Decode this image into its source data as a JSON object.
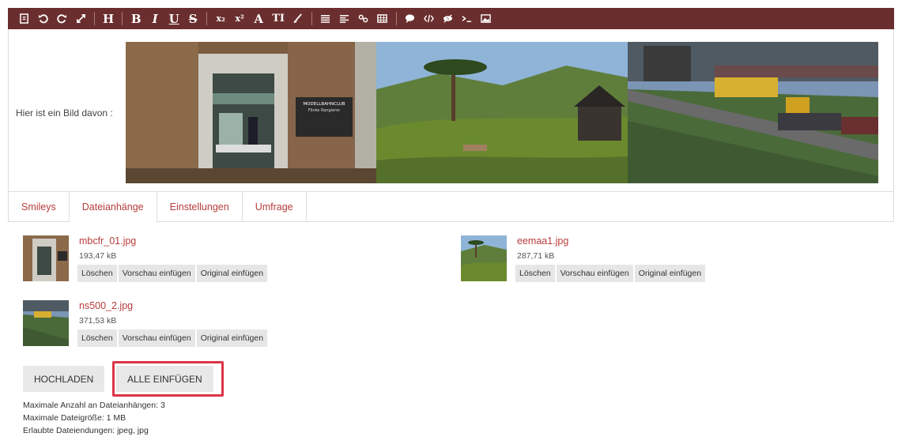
{
  "toolbar": {
    "buttons": [
      {
        "name": "source-icon",
        "label": ""
      },
      {
        "name": "undo-icon",
        "label": ""
      },
      {
        "name": "redo-icon",
        "label": ""
      },
      {
        "name": "fullscreen-icon",
        "label": ""
      },
      {
        "name": "heading-button",
        "label": "H"
      },
      {
        "name": "bold-button",
        "label": "B"
      },
      {
        "name": "italic-button",
        "label": "I"
      },
      {
        "name": "underline-button",
        "label": "U"
      },
      {
        "name": "strikethrough-button",
        "label": "S"
      },
      {
        "name": "subscript-button",
        "label": "x₂"
      },
      {
        "name": "superscript-button",
        "label": "x²"
      },
      {
        "name": "font-color-button",
        "label": "A"
      },
      {
        "name": "font-size-button",
        "label": "TI"
      },
      {
        "name": "brush-icon",
        "label": ""
      },
      {
        "name": "list-icon",
        "label": ""
      },
      {
        "name": "align-icon",
        "label": ""
      },
      {
        "name": "link-icon",
        "label": ""
      },
      {
        "name": "table-icon",
        "label": ""
      },
      {
        "name": "quote-icon",
        "label": ""
      },
      {
        "name": "code-icon",
        "label": ""
      },
      {
        "name": "spoiler-icon",
        "label": ""
      },
      {
        "name": "terminal-icon",
        "label": ""
      },
      {
        "name": "image-icon",
        "label": ""
      }
    ]
  },
  "editor": {
    "text": "Hier ist ein Bild davon :",
    "image_sign": {
      "line1": "MODELLBAHNCLUB",
      "line2": "Flinke Rangierer"
    }
  },
  "tabs": [
    {
      "label": "Smileys",
      "active": false
    },
    {
      "label": "Dateianhänge",
      "active": true
    },
    {
      "label": "Einstellungen",
      "active": false
    },
    {
      "label": "Umfrage",
      "active": false
    }
  ],
  "attachments": [
    {
      "filename": "mbcfr_01.jpg",
      "size": "193,47 kB"
    },
    {
      "filename": "eemaa1.jpg",
      "size": "287,71 kB"
    },
    {
      "filename": "ns500_2.jpg",
      "size": "371,53 kB"
    }
  ],
  "attachment_buttons": {
    "delete": "Löschen",
    "insert_preview": "Vorschau einfügen",
    "insert_original": "Original einfügen"
  },
  "upload": {
    "upload_label": "HOCHLADEN",
    "insert_all_label": "ALLE EINFÜGEN"
  },
  "info": {
    "max_count": "Maximale Anzahl an Dateianhängen: 3",
    "max_size": "Maximale Dateigröße: 1 MB",
    "allowed_ext": "Erlaubte Dateiendungen: jpeg, jpg"
  },
  "colors": {
    "toolbar_bg": "#6b2e2e",
    "accent": "#b73c3c",
    "highlight": "#dc3545"
  }
}
